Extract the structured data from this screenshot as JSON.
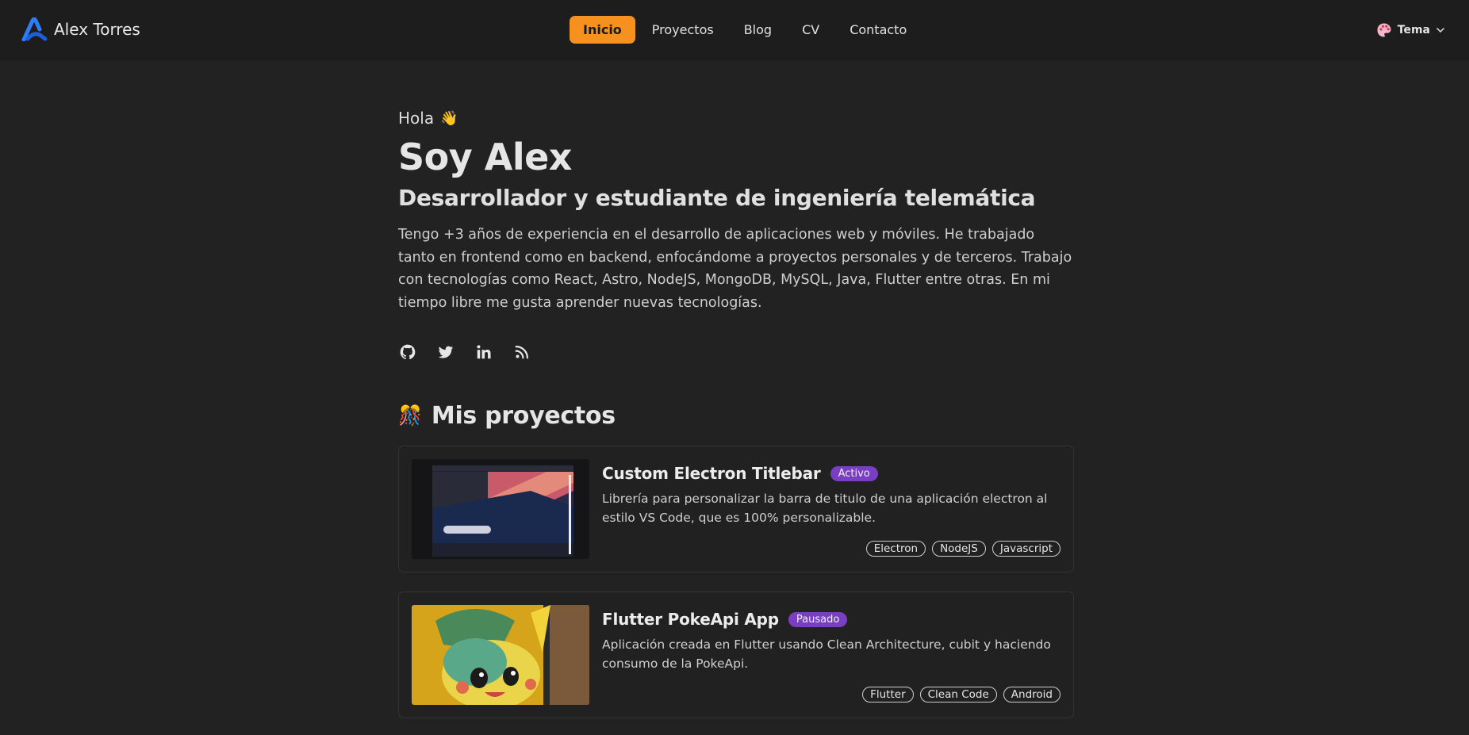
{
  "header": {
    "brand_name": "Alex Torres",
    "nav": [
      {
        "label": "Inicio",
        "active": true
      },
      {
        "label": "Proyectos",
        "active": false
      },
      {
        "label": "Blog",
        "active": false
      },
      {
        "label": "CV",
        "active": false
      },
      {
        "label": "Contacto",
        "active": false
      }
    ],
    "theme_label": "Tema",
    "theme_icon": "palette-icon"
  },
  "hero": {
    "greeting": "Hola",
    "greeting_emoji": "👋",
    "title": "Soy Alex",
    "subtitle": "Desarrollador y estudiante de ingeniería telemática",
    "bio": "Tengo +3 años de experiencia en el desarrollo de aplicaciones web y móviles. He trabajado tanto en frontend como en backend, enfocándome a proyectos personales y de terceros. Trabajo con tecnologías como React, Astro, NodeJS, MongoDB, MySQL, Java, Flutter entre otras. En mi tiempo libre me gusta aprender nuevas tecnologías.",
    "socials": [
      "github-icon",
      "twitter-icon",
      "linkedin-icon",
      "rss-icon"
    ]
  },
  "projects_section": {
    "title": "Mis proyectos",
    "emoji": "🎊"
  },
  "projects": [
    {
      "title": "Custom Electron Titlebar",
      "status": "Activo",
      "description": "Librería para personalizar la barra de titulo de una aplicación electron al estilo VS Code, que es 100% personalizable.",
      "tags": [
        "Electron",
        "NodeJS",
        "Javascript"
      ]
    },
    {
      "title": "Flutter PokeApi App",
      "status": "Pausado",
      "description": "Aplicación creada en Flutter usando Clean Architecture, cubit y haciendo consumo de la PokeApi.",
      "tags": [
        "Flutter",
        "Clean Code",
        "Android"
      ]
    }
  ],
  "colors": {
    "background": "#222222",
    "header": "#1d1d1d",
    "accent": "#f6901e",
    "badge": "#7a3fc0"
  }
}
